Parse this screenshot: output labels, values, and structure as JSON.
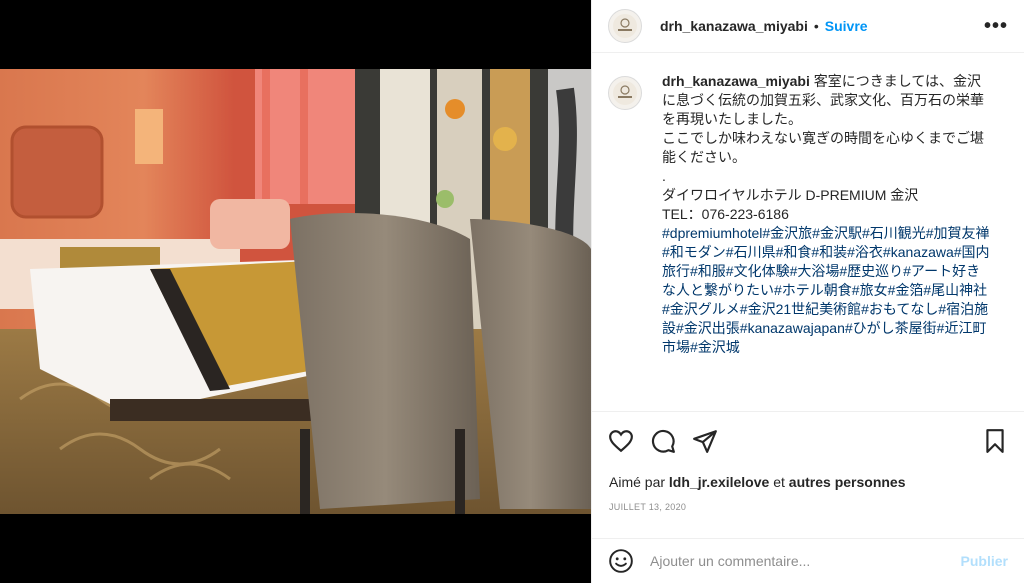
{
  "post": {
    "username": "drh_kanazawa_miyabi",
    "follow_label": "Suivre",
    "more_icon": "more-horizontal-icon"
  },
  "caption": {
    "username": "drh_kanazawa_miyabi",
    "line1": "客室につきましては、金沢に息づく伝統の加賀五彩、武家文化、百万石の栄華を再現いたしました。",
    "line2": "ここでしか味わえない寛ぎの時間を心ゆくまでご堪能ください。",
    "line3": ".",
    "line4": "ダイワロイヤルホテル D-PREMIUM 金沢",
    "line5": "TEL：076-223-6186",
    "hashtags": "#dpremiumhotel#金沢旅#金沢駅#石川観光#加賀友禅#和モダン#石川県#和食#和装#浴衣#kanazawa#国内旅行#和服#文化体験#大浴場#歴史巡り#アート好きな人と繋がりたい#ホテル朝食#旅女#金箔#尾山神社#金沢グルメ#金沢21世紀美術館#おもてなし#宿泊施設#金沢出張#kanazawajapan#ひがし茶屋街#近江町市場#金沢城"
  },
  "likes": {
    "prefix": "Aimé par",
    "user": "ldh_jr.exilelove",
    "middle": "et",
    "others": "autres personnes"
  },
  "date": "JUILLET 13, 2020",
  "comment": {
    "placeholder": "Ajouter un commentaire...",
    "publish_label": "Publier"
  },
  "colors": {
    "link_blue": "#0095f6",
    "hashtag_blue": "#00376b",
    "publish_disabled": "#b2dffc",
    "muted": "#8e8e8e"
  }
}
